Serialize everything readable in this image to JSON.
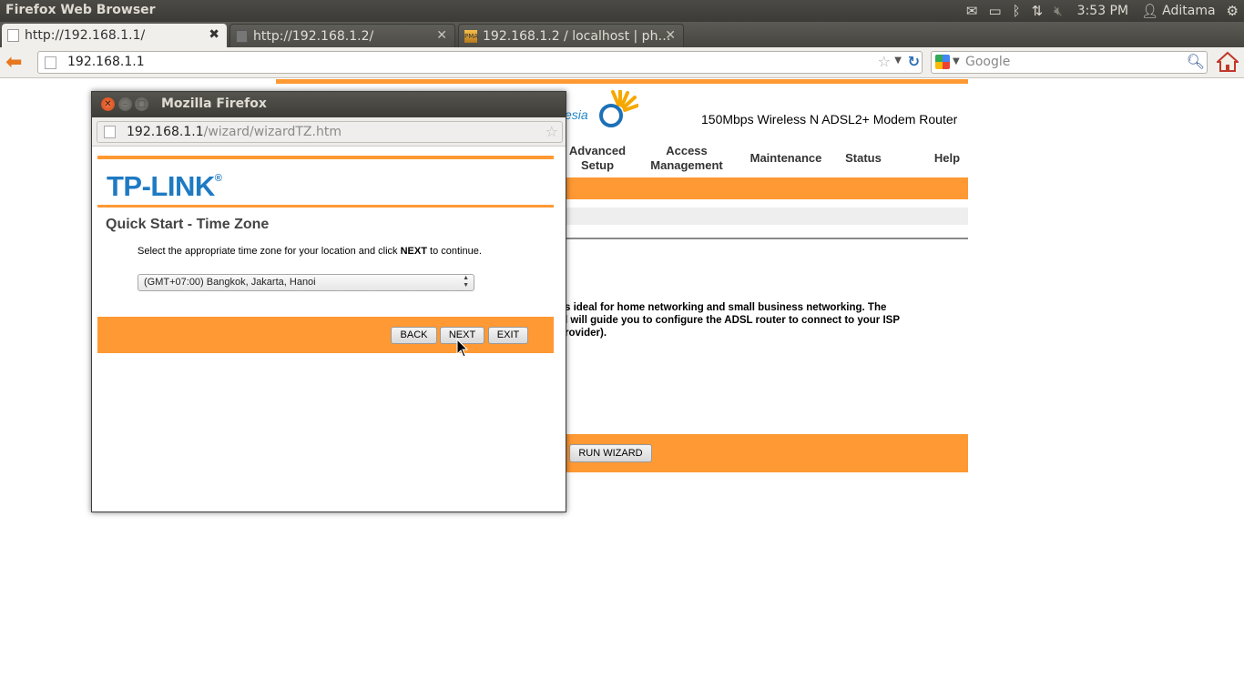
{
  "panel": {
    "app_title": "Firefox Web Browser",
    "clock": "3:53 PM",
    "user": "Aditama"
  },
  "tabs": [
    {
      "label": "http://192.168.1.1/",
      "active": true
    },
    {
      "label": "http://192.168.1.2/",
      "active": false
    },
    {
      "label": "192.168.1.2 / localhost | ph…",
      "active": false
    }
  ],
  "navbar": {
    "url": "192.168.1.1",
    "search_placeholder": "Google"
  },
  "router_page": {
    "product_name": "150Mbps Wireless N ADSL2+ Modem Router",
    "logo_text": "esia",
    "menu": [
      "Advanced\nSetup",
      "Access\nManagement",
      "Maintenance",
      "Status",
      "Help"
    ],
    "description": "s ideal for home networking and small business networking. The\nl will guide you to configure the ADSL router to connect to your ISP\nrovider).",
    "run_wizard_label": "RUN WIZARD"
  },
  "popup": {
    "window_title": "Mozilla Firefox",
    "url_host": "192.168.1.1",
    "url_path": "/wizard/wizardTZ.htm",
    "logo": "TP-LINK",
    "logo_mark": "®",
    "heading": "Quick Start - Time Zone",
    "instruction_before": "Select the appropriate time zone for your location and click ",
    "instruction_bold": "NEXT",
    "instruction_after": " to continue.",
    "timezone_selected": "(GMT+07:00) Bangkok, Jakarta, Hanoi",
    "buttons": {
      "back": "BACK",
      "next": "NEXT",
      "exit": "EXIT"
    }
  },
  "colors": {
    "tplink_orange": "#ff9933",
    "tplink_blue": "#1e7ac3",
    "ubuntu_panel": "#3c3b37"
  }
}
